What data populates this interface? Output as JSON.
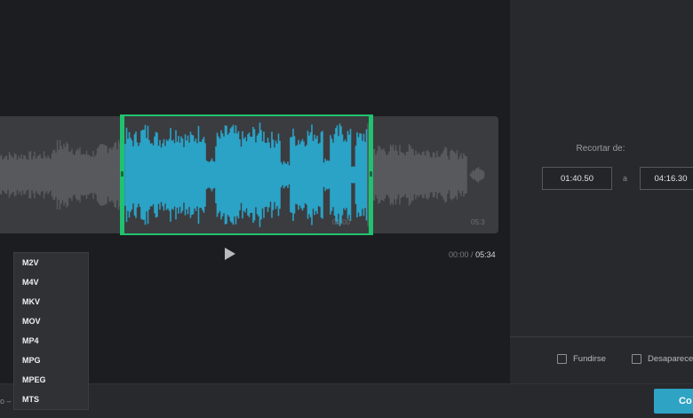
{
  "timeline": {
    "current_time": "00:00",
    "separator": "/",
    "total_time": "05:34",
    "tick_labels": [
      "04:00",
      "05:3"
    ]
  },
  "trim": {
    "label": "Recortar de:",
    "from": "01:40.50",
    "connector": "a",
    "to": "04:16.30"
  },
  "effects": {
    "fade_in": {
      "label": "Fundirse",
      "checked": false
    },
    "fade_out": {
      "label": "Desaparece",
      "checked": false
    }
  },
  "format_dropdown": {
    "label_fragment": "o –",
    "options": [
      "M2V",
      "M4V",
      "MKV",
      "MOV",
      "MP4",
      "MPG",
      "MPEG",
      "MTS"
    ]
  },
  "save_button": {
    "label": "Co"
  },
  "colors": {
    "selection_border": "#1fc36f",
    "selected_wave": "#2aa3c7",
    "unselected_wave": "#5a5b60",
    "accent_button": "#2fa3c4"
  },
  "icons": {
    "play": "play-icon"
  }
}
